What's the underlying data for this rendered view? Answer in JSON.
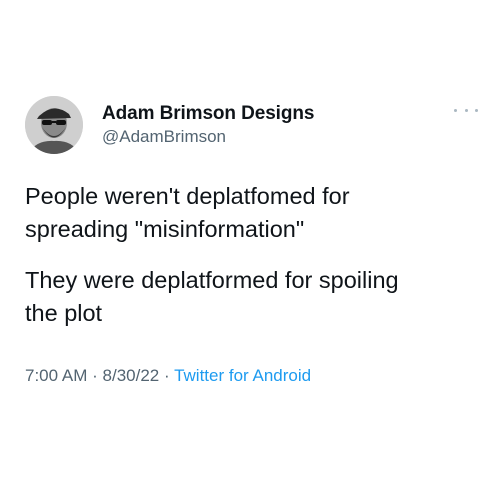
{
  "author": {
    "display_name": "Adam Brimson Designs",
    "handle": "@AdamBrimson"
  },
  "tweet": {
    "paragraph_1_line_1": "People weren't deplatfomed for",
    "paragraph_1_line_2": "spreading \"misinformation\"",
    "paragraph_2_line_1": "They were deplatformed for spoiling",
    "paragraph_2_line_2": "the plot"
  },
  "meta": {
    "time": "7:00 AM",
    "separator": "·",
    "date": "8/30/22",
    "source": "Twitter for Android"
  },
  "icons": {
    "more": "more-options-icon",
    "avatar": "profile-avatar"
  },
  "colors": {
    "text": "#0f1419",
    "secondary": "#536471",
    "link": "#1d9bf0"
  }
}
